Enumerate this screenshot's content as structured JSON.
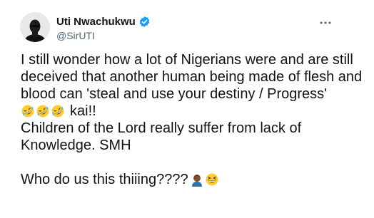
{
  "author": {
    "display_name": "Uti Nwachukwu",
    "handle": "@SirUTI",
    "verified": true,
    "avatar_icon": "profile-photo"
  },
  "menu": {
    "icon": "more-horizontal-icon"
  },
  "tweet": {
    "line1": "I still wonder how a lot of Nigerians were and are still",
    "line2": "deceived that another human being made of flesh and",
    "line3": "blood can 'steal and use your destiny / Progress'",
    "line4_emojis": [
      "rolling-on-floor-laughing",
      "rolling-on-floor-laughing",
      "rolling-on-floor-laughing"
    ],
    "line4_text": "kai!!",
    "line5": "Children of the Lord really suffer from lack of",
    "line6": "Knowledge. SMH",
    "line7_text": "Who do us this thiiing????",
    "line7_emojis": [
      "person-facepalming",
      "grinning-squinting-face"
    ]
  },
  "colors": {
    "text": "#0f1419",
    "secondary": "#536471",
    "verified_blue": "#1d9bf0",
    "emoji_yellow": "#ffcc33"
  }
}
